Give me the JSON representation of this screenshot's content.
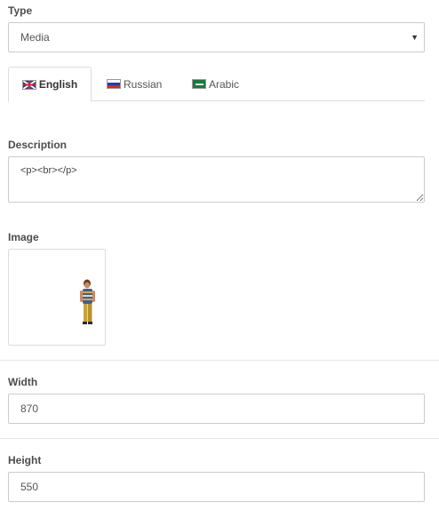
{
  "type": {
    "label": "Type",
    "selected": "Media"
  },
  "tabs": [
    {
      "label": "English",
      "flag": "uk-flag-icon",
      "active": true
    },
    {
      "label": "Russian",
      "flag": "russia-flag-icon",
      "active": false
    },
    {
      "label": "Arabic",
      "flag": "saudi-arabia-flag-icon",
      "active": false
    }
  ],
  "description": {
    "label": "Description",
    "value": "<p><br></p>"
  },
  "image": {
    "label": "Image",
    "thumbnail": "person-photo"
  },
  "width": {
    "label": "Width",
    "value": "870"
  },
  "height": {
    "label": "Height",
    "value": "550"
  }
}
